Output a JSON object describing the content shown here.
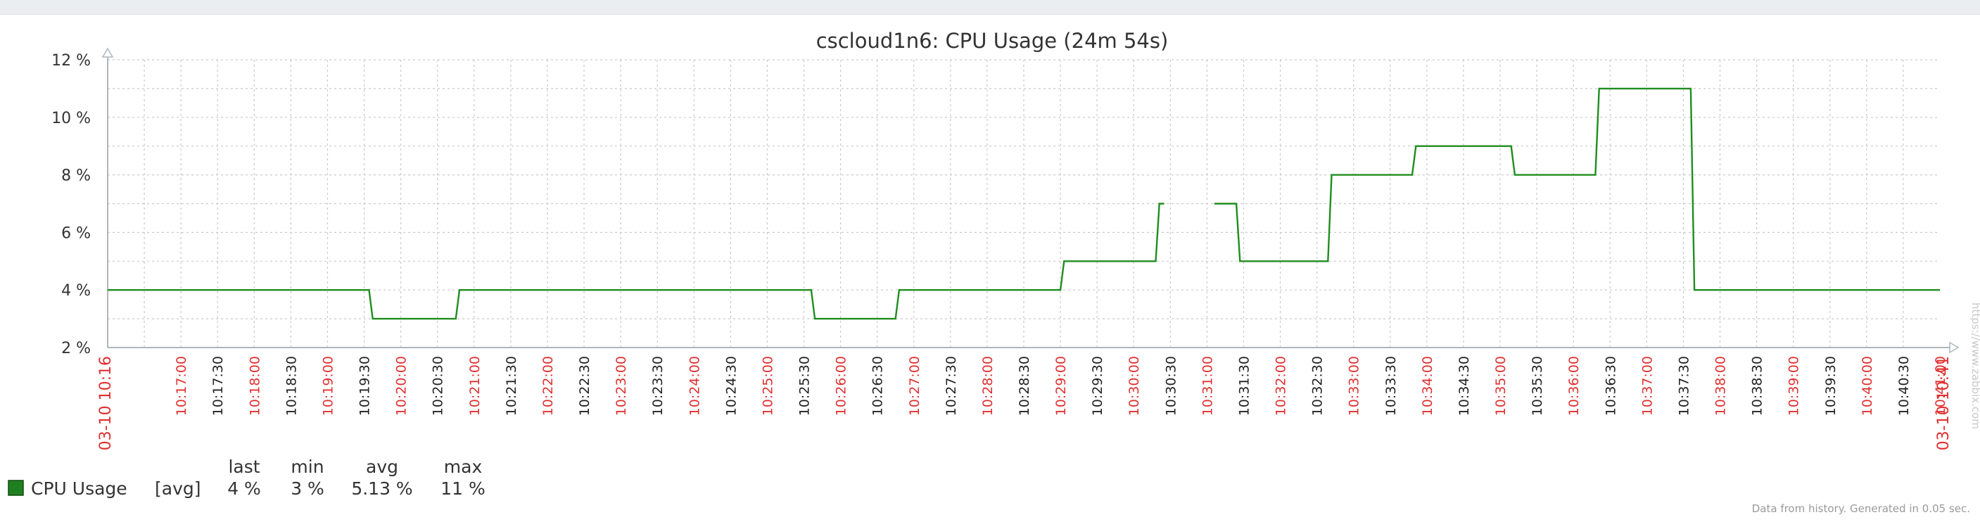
{
  "footer_note": "Data from history. Generated in 0.05 sec.",
  "watermark": "https://www.zabbix.com",
  "colors": {
    "series": "#1f8d1f",
    "legend_swatch": "#1f7f1f",
    "axis": "#aeb7bd",
    "grid": "#c9c9c9",
    "major_tick_label": "#e03030",
    "minor_tick_label": "#222222",
    "title": "#333333"
  },
  "chart_data": {
    "type": "line",
    "title": "cscloud1n6: CPU Usage (24m 54s)",
    "xlabel": "",
    "ylabel": "",
    "grid": true,
    "ylim": [
      2,
      12
    ],
    "y_ticks": [
      {
        "value": 2,
        "label": "2 %"
      },
      {
        "value": 4,
        "label": "4 %"
      },
      {
        "value": 6,
        "label": "6 %"
      },
      {
        "value": 8,
        "label": "8 %"
      },
      {
        "value": 10,
        "label": "10 %"
      },
      {
        "value": 12,
        "label": "12 %"
      }
    ],
    "xlim": [
      "10:16:00",
      "10:41:00"
    ],
    "x_tick_labels": [
      {
        "time": "10:16:00",
        "label": "03-10 10:16",
        "major": true
      },
      {
        "time": "10:17:00",
        "label": "10:17:00",
        "major": true
      },
      {
        "time": "10:17:30",
        "label": "10:17:30",
        "major": false
      },
      {
        "time": "10:18:00",
        "label": "10:18:00",
        "major": true
      },
      {
        "time": "10:18:30",
        "label": "10:18:30",
        "major": false
      },
      {
        "time": "10:19:00",
        "label": "10:19:00",
        "major": true
      },
      {
        "time": "10:19:30",
        "label": "10:19:30",
        "major": false
      },
      {
        "time": "10:20:00",
        "label": "10:20:00",
        "major": true
      },
      {
        "time": "10:20:30",
        "label": "10:20:30",
        "major": false
      },
      {
        "time": "10:21:00",
        "label": "10:21:00",
        "major": true
      },
      {
        "time": "10:21:30",
        "label": "10:21:30",
        "major": false
      },
      {
        "time": "10:22:00",
        "label": "10:22:00",
        "major": true
      },
      {
        "time": "10:22:30",
        "label": "10:22:30",
        "major": false
      },
      {
        "time": "10:23:00",
        "label": "10:23:00",
        "major": true
      },
      {
        "time": "10:23:30",
        "label": "10:23:30",
        "major": false
      },
      {
        "time": "10:24:00",
        "label": "10:24:00",
        "major": true
      },
      {
        "time": "10:24:30",
        "label": "10:24:30",
        "major": false
      },
      {
        "time": "10:25:00",
        "label": "10:25:00",
        "major": true
      },
      {
        "time": "10:25:30",
        "label": "10:25:30",
        "major": false
      },
      {
        "time": "10:26:00",
        "label": "10:26:00",
        "major": true
      },
      {
        "time": "10:26:30",
        "label": "10:26:30",
        "major": false
      },
      {
        "time": "10:27:00",
        "label": "10:27:00",
        "major": true
      },
      {
        "time": "10:27:30",
        "label": "10:27:30",
        "major": false
      },
      {
        "time": "10:28:00",
        "label": "10:28:00",
        "major": true
      },
      {
        "time": "10:28:30",
        "label": "10:28:30",
        "major": false
      },
      {
        "time": "10:29:00",
        "label": "10:29:00",
        "major": true
      },
      {
        "time": "10:29:30",
        "label": "10:29:30",
        "major": false
      },
      {
        "time": "10:30:00",
        "label": "10:30:00",
        "major": true
      },
      {
        "time": "10:30:30",
        "label": "10:30:30",
        "major": false
      },
      {
        "time": "10:31:00",
        "label": "10:31:00",
        "major": true
      },
      {
        "time": "10:31:30",
        "label": "10:31:30",
        "major": false
      },
      {
        "time": "10:32:00",
        "label": "10:32:00",
        "major": true
      },
      {
        "time": "10:32:30",
        "label": "10:32:30",
        "major": false
      },
      {
        "time": "10:33:00",
        "label": "10:33:00",
        "major": true
      },
      {
        "time": "10:33:30",
        "label": "10:33:30",
        "major": false
      },
      {
        "time": "10:34:00",
        "label": "10:34:00",
        "major": true
      },
      {
        "time": "10:34:30",
        "label": "10:34:30",
        "major": false
      },
      {
        "time": "10:35:00",
        "label": "10:35:00",
        "major": true
      },
      {
        "time": "10:35:30",
        "label": "10:35:30",
        "major": false
      },
      {
        "time": "10:36:00",
        "label": "10:36:00",
        "major": true
      },
      {
        "time": "10:36:30",
        "label": "10:36:30",
        "major": false
      },
      {
        "time": "10:37:00",
        "label": "10:37:00",
        "major": true
      },
      {
        "time": "10:37:30",
        "label": "10:37:30",
        "major": false
      },
      {
        "time": "10:38:00",
        "label": "10:38:00",
        "major": true
      },
      {
        "time": "10:38:30",
        "label": "10:38:30",
        "major": false
      },
      {
        "time": "10:39:00",
        "label": "10:39:00",
        "major": true
      },
      {
        "time": "10:39:30",
        "label": "10:39:30",
        "major": false
      },
      {
        "time": "10:40:00",
        "label": "10:40:00",
        "major": true
      },
      {
        "time": "10:40:30",
        "label": "10:40:30",
        "major": false
      },
      {
        "time": "10:41:00",
        "label": "10:41:00",
        "major": true
      },
      {
        "time": "10:41:00",
        "label": "03-10 10:41",
        "major": true
      }
    ],
    "series": [
      {
        "name": "CPU Usage",
        "color": "#1f8d1f",
        "segments": [
          [
            {
              "x": "10:16:00",
              "y": 4
            },
            {
              "x": "10:19:34",
              "y": 4
            },
            {
              "x": "10:19:37",
              "y": 3
            },
            {
              "x": "10:20:45",
              "y": 3
            },
            {
              "x": "10:20:48",
              "y": 4
            },
            {
              "x": "10:25:36",
              "y": 4
            },
            {
              "x": "10:25:39",
              "y": 3
            },
            {
              "x": "10:26:45",
              "y": 3
            },
            {
              "x": "10:26:48",
              "y": 4
            },
            {
              "x": "10:29:00",
              "y": 4
            },
            {
              "x": "10:29:03",
              "y": 5
            },
            {
              "x": "10:30:18",
              "y": 5
            },
            {
              "x": "10:30:21",
              "y": 7
            },
            {
              "x": "10:30:25",
              "y": 7
            }
          ],
          [
            {
              "x": "10:31:06",
              "y": 7
            },
            {
              "x": "10:31:24",
              "y": 7
            },
            {
              "x": "10:31:27",
              "y": 5
            },
            {
              "x": "10:32:39",
              "y": 5
            },
            {
              "x": "10:32:42",
              "y": 8
            },
            {
              "x": "10:33:48",
              "y": 8
            },
            {
              "x": "10:33:51",
              "y": 9
            },
            {
              "x": "10:35:09",
              "y": 9
            },
            {
              "x": "10:35:12",
              "y": 8
            },
            {
              "x": "10:36:18",
              "y": 8
            },
            {
              "x": "10:36:21",
              "y": 11
            },
            {
              "x": "10:37:36",
              "y": 11
            },
            {
              "x": "10:37:39",
              "y": 4
            },
            {
              "x": "10:41:00",
              "y": 4
            }
          ]
        ]
      }
    ],
    "legend": {
      "placement": "bottom-left",
      "headers": {
        "last": "last",
        "min": "min",
        "avg": "avg",
        "max": "max"
      },
      "rows": [
        {
          "name": "CPU Usage",
          "func": "[avg]",
          "last": "4 %",
          "min": "3 %",
          "avg": "5.13 %",
          "max": "11 %"
        }
      ]
    }
  }
}
